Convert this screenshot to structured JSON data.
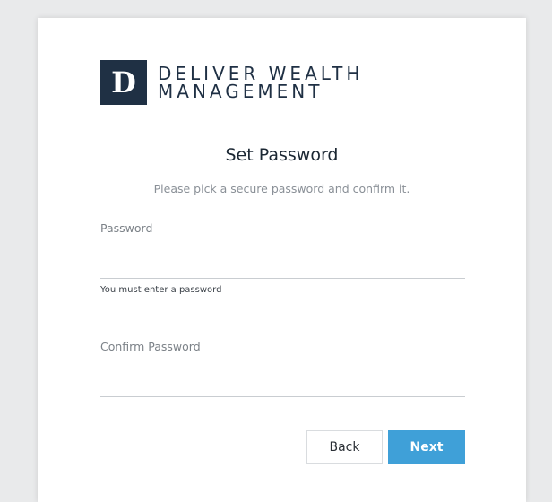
{
  "brand": {
    "logo_letter": "D",
    "name_line1": "DELIVER WEALTH",
    "name_line2": "MANAGEMENT"
  },
  "form": {
    "title": "Set Password",
    "subtitle": "Please pick a secure password and confirm it.",
    "password_label": "Password",
    "password_value": "",
    "password_error": "You must enter a password",
    "confirm_label": "Confirm Password",
    "confirm_value": ""
  },
  "actions": {
    "back_label": "Back",
    "next_label": "Next"
  },
  "colors": {
    "brand_navy": "#1f3044",
    "accent_blue": "#3fa0d8"
  }
}
